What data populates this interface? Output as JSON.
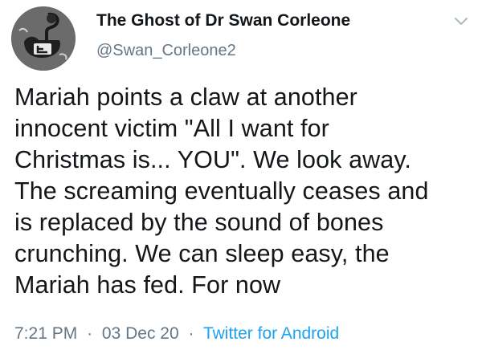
{
  "tweet": {
    "display_name": "The Ghost of Dr Swan Corleone",
    "handle": "@Swan_Corleone2",
    "text_lines": [
      "Mariah points a claw at another",
      "innocent victim \"All I want for",
      "Christmas is... YOU\". We look away.",
      "The screaming eventually ceases and",
      "is replaced by the sound of bones",
      "crunching. We can sleep easy, the",
      "Mariah has fed. For now"
    ],
    "time": "7:21 PM",
    "date": "03 Dec 20",
    "source": "Twitter for Android",
    "separator": "·"
  },
  "icons": {
    "avatar": "profile-avatar-swan",
    "menu": "chevron-down-icon"
  },
  "colors": {
    "text": "#14171a",
    "secondary": "#657786",
    "link": "#1da1f2",
    "background": "#ffffff"
  }
}
